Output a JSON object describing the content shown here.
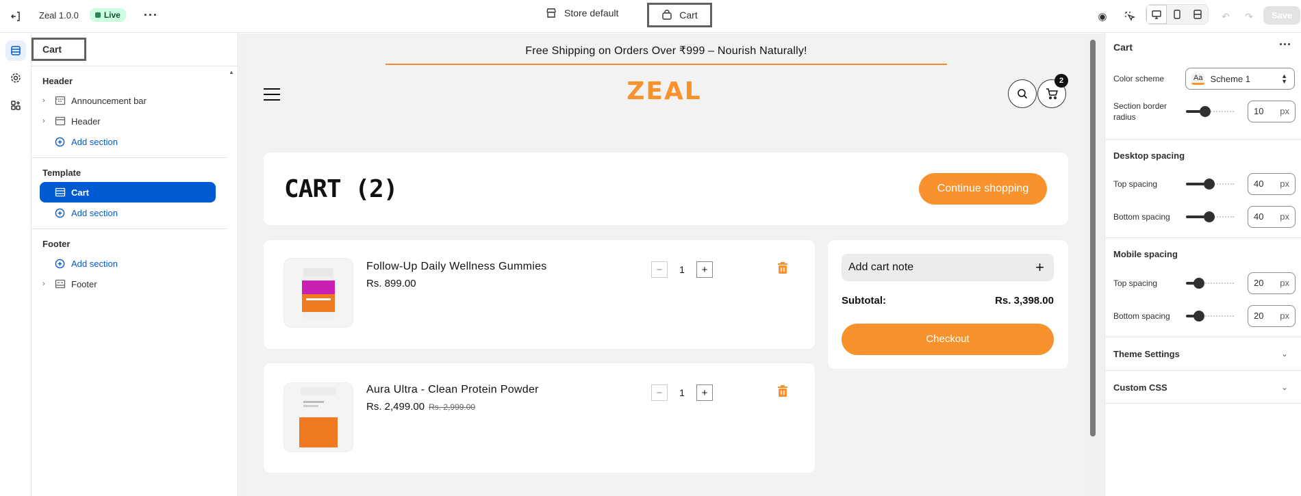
{
  "topbar": {
    "app_name": "Zeal 1.0.0",
    "status": "Live",
    "template_select": "Store default",
    "page_select": "Cart",
    "save_label": "Save"
  },
  "left_panel": {
    "title": "Cart",
    "groups": [
      {
        "heading": "Header",
        "items": [
          "Announcement bar",
          "Header"
        ],
        "add": "Add section"
      },
      {
        "heading": "Template",
        "items": [
          "Cart"
        ],
        "add": "Add section"
      },
      {
        "heading": "Footer",
        "add": "Add section",
        "items": [
          "Footer"
        ]
      }
    ]
  },
  "preview": {
    "announcement": "Free Shipping on Orders Over ₹999 – Nourish Naturally!",
    "logo": "ZEAL",
    "cart_count": "2",
    "cart_title": "CART (2)",
    "continue_label": "Continue shopping",
    "items": [
      {
        "name": "Follow-Up Daily Wellness Gummies",
        "price": "Rs. 899.00",
        "compare": "",
        "qty": "1"
      },
      {
        "name": "Aura Ultra - Clean Protein Powder",
        "price": "Rs. 2,499.00",
        "compare": "Rs. 2,999.00",
        "qty": "1"
      }
    ],
    "note_label": "Add cart note",
    "subtotal_label": "Subtotal:",
    "subtotal_value": "Rs. 3,398.00",
    "checkout_label": "Checkout"
  },
  "right_panel": {
    "title": "Cart",
    "color_scheme_label": "Color scheme",
    "color_scheme_value": "Scheme 1",
    "color_scheme_icon": "Aa",
    "radius_label": "Section border radius",
    "radius_value": "10",
    "unit": "px",
    "desktop_heading": "Desktop spacing",
    "mobile_heading": "Mobile spacing",
    "top_label": "Top spacing",
    "bottom_label": "Bottom spacing",
    "desktop_top": "40",
    "desktop_bottom": "40",
    "mobile_top": "20",
    "mobile_bottom": "20",
    "theme_settings": "Theme Settings",
    "custom_css": "Custom CSS"
  },
  "colors": {
    "accent": "#f7922c",
    "selected": "#005bd3",
    "live_bg": "#cdfee1"
  }
}
